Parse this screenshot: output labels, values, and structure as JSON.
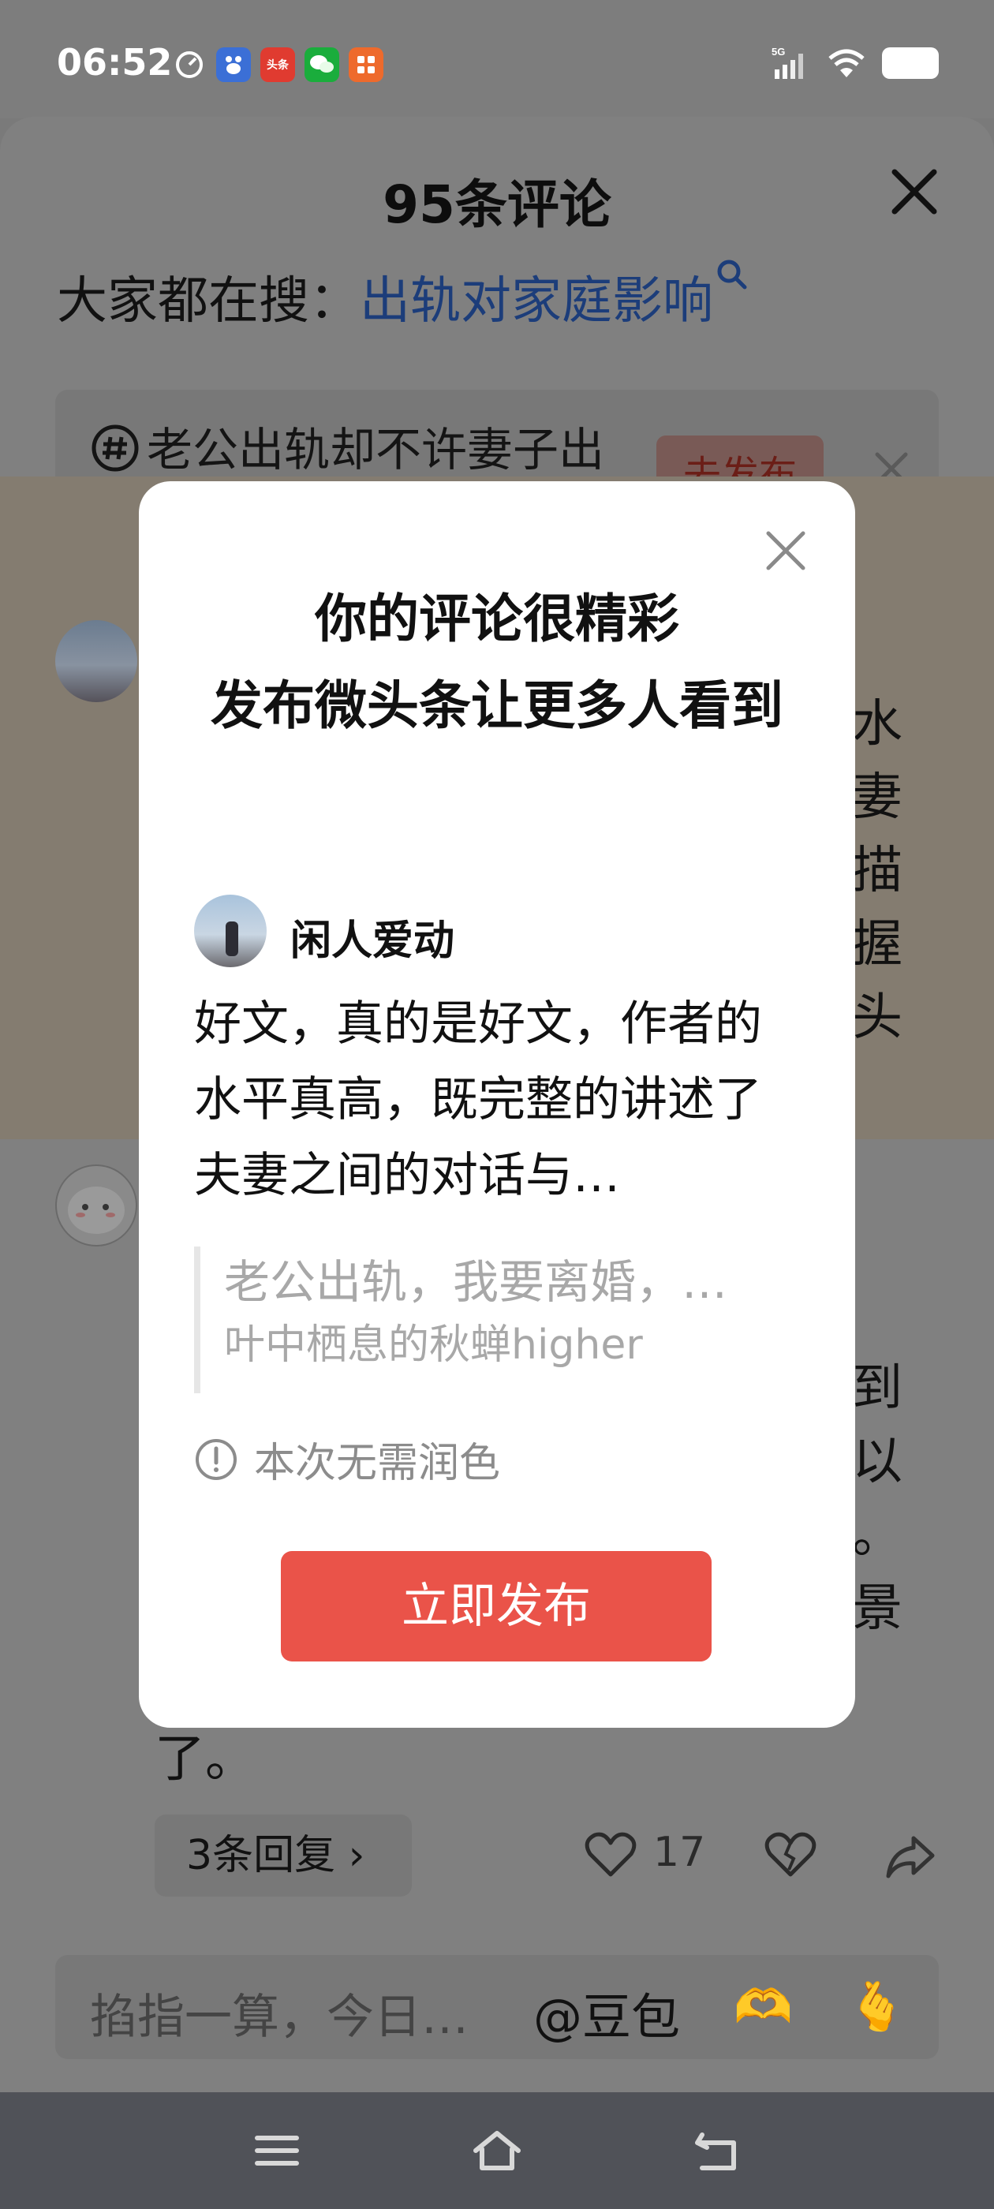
{
  "status_bar": {
    "time": "06:52",
    "network": "5G",
    "app_icons": [
      "timer-icon",
      "baidu-icon",
      "toutiao-icon",
      "wechat-icon",
      "app-icon"
    ],
    "toutiao_badge": "头条"
  },
  "sheet": {
    "title": "95条评论",
    "search_prefix": "大家都在搜：",
    "search_keyword": "出轨对家庭影响",
    "topic": {
      "text": "老公出轨却不许妻子出",
      "button": "去发布"
    },
    "comment1_fragments": [
      "水",
      "妻",
      "描",
      "握",
      "头"
    ],
    "comment2_fragments": [
      "到",
      "以",
      "。",
      "景"
    ],
    "comment2_end": "了。",
    "replies_label": "3条回复 ›",
    "like_count": "17",
    "input_placeholder": "掐指一算，今日…",
    "at_doubao": "@豆包",
    "emojis": [
      "🫶",
      "🫰"
    ]
  },
  "dialog": {
    "title_line1": "你的评论很精彩",
    "title_line2": "发布微头条让更多人看到",
    "username": "闲人爱动",
    "comment_text": "好文，真的是好文，作者的水平真高，既完整的讲述了夫妻之间的对话与…",
    "quote_title": "老公出轨，我要离婚，…",
    "quote_author": "叶中栖息的秋蝉higher",
    "no_polish": "本次无需润色",
    "publish_button": "立即发布"
  },
  "colors": {
    "accent_red": "#ea5349",
    "link_blue": "#1c3d7a",
    "overlay_gray": "#808080"
  }
}
